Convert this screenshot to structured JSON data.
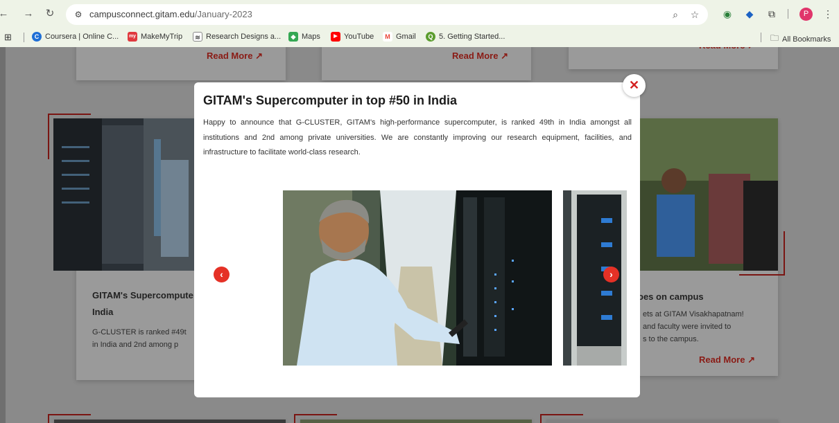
{
  "browser": {
    "url_host": "campusconnect.gitam.edu",
    "url_path": "/January-2023",
    "avatar_letter": "P",
    "bookmarks": [
      {
        "label": "Coursera | Online C...",
        "color": "#1f6fd6",
        "glyph": "C"
      },
      {
        "label": "MakeMyTrip",
        "color": "#e0393e",
        "glyph": "my"
      },
      {
        "label": "Research Designs a...",
        "color": "#666666",
        "glyph": "≋"
      },
      {
        "label": "Maps",
        "color": "#34a853",
        "glyph": "◆"
      },
      {
        "label": "YouTube",
        "color": "#ff0000",
        "glyph": "▶"
      },
      {
        "label": "Gmail",
        "color": "#ea4335",
        "glyph": "M"
      },
      {
        "label": "5. Getting Started...",
        "color": "#5b9d2e",
        "glyph": "Q"
      }
    ],
    "all_bookmarks": "All Bookmarks"
  },
  "page": {
    "readmore_label": "Read More ↗",
    "card_left": {
      "title_line1": "GITAM's Supercompute",
      "title_line2": "India",
      "text_line1": "G-CLUSTER is ranked #49t",
      "text_line2": "in India  and 2nd among p"
    },
    "card_right": {
      "title": "oes on campus",
      "text_line1": "ets at GITAM Visakhapatnam!",
      "text_line2": "and faculty were invited to",
      "text_line3": "s to the campus."
    }
  },
  "modal": {
    "title": "GITAM's Supercomputer in top #50 in India",
    "body": "Happy to announce that G-CLUSTER, GITAM's high-performance supercomputer, is ranked 49th in India amongst all institutions and 2nd among private universities. We are constantly improving our research equipment, facilities, and infrastructure to facilitate world-class research.",
    "close_glyph": "✕",
    "prev_glyph": "‹",
    "next_glyph": "›"
  },
  "colors": {
    "accent_red": "#e53126",
    "readmore_dim": "#8a1b15",
    "chrome_bg": "#eef3e7"
  }
}
